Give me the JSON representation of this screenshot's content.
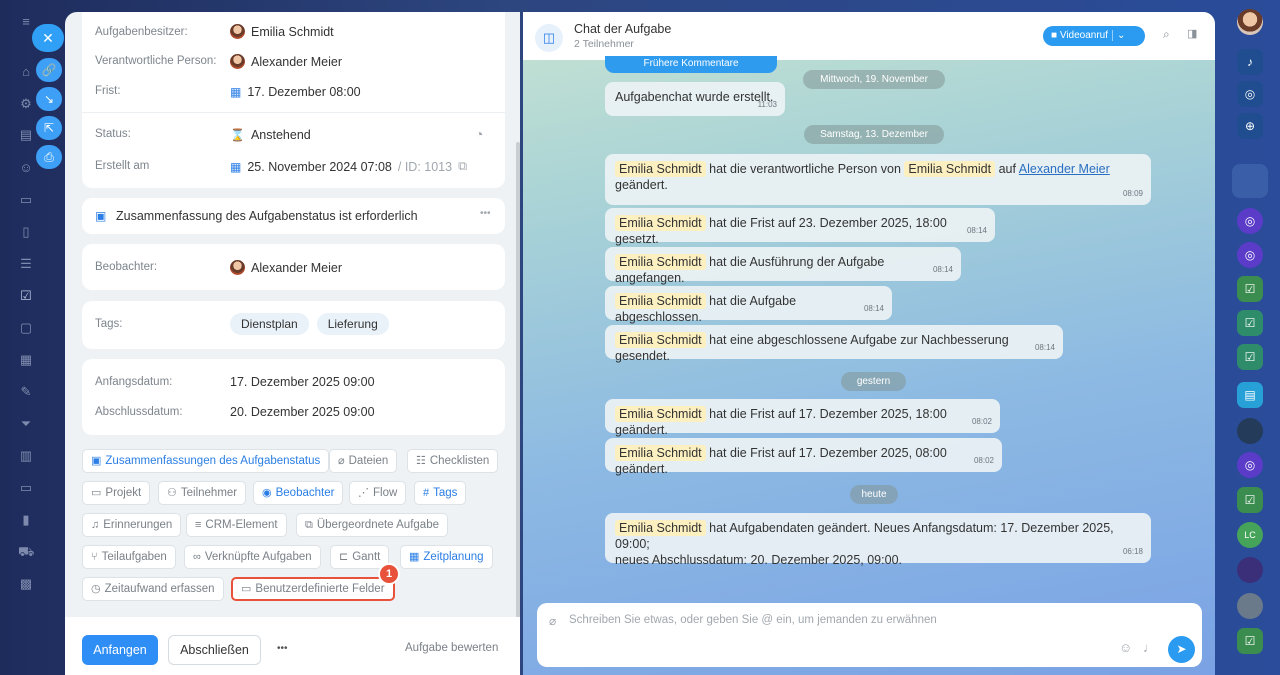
{
  "task": {
    "owner_label": "Aufgabenbesitzer:",
    "owner_name": "Emilia Schmidt",
    "responsible_label": "Verantwortliche Person:",
    "responsible_name": "Alexander Meier",
    "deadline_label": "Frist:",
    "deadline_value": "17. Dezember 08:00",
    "status_label": "Status:",
    "status_value": "Anstehend",
    "created_label": "Erstellt am",
    "created_value": "25. November 2024 07:08",
    "id_text": "/ ID: 1013",
    "summary_text": "Zusammenfassung des Aufgabenstatus ist erforderlich",
    "observer_label": "Beobachter:",
    "observer_name": "Alexander Meier",
    "tags_label": "Tags:",
    "tags": [
      "Dienstplan",
      "Lieferung"
    ],
    "start_label": "Anfangsdatum:",
    "start_value": "17. Dezember 2025 09:00",
    "end_label": "Abschlussdatum:",
    "end_value": "20. Dezember 2025 09:00",
    "chips": [
      "Zusammenfassungen des Aufgabenstatus",
      "Dateien",
      "Checklisten",
      "Projekt",
      "Teilnehmer",
      "Beobachter",
      "Flow",
      "Tags",
      "Erinnerungen",
      "CRM-Element",
      "Übergeordnete Aufgabe",
      "Teilaufgaben",
      "Verknüpfte Aufgaben",
      "Gantt",
      "Zeitplanung",
      "Zeitaufwand erfassen",
      "Benutzerdefinierte Felder"
    ],
    "badge_number": "1",
    "start_button": "Anfangen",
    "finish_button": "Abschließen",
    "more_button": "•••",
    "rate_link": "Aufgabe bewerten"
  },
  "chat": {
    "title": "Chat der Aufgabe",
    "subtitle": "2 Teilnehmer",
    "video_button": "Videoanruf",
    "earlier_comments": "Frühere Kommentare",
    "dates": [
      "Mittwoch, 19. November",
      "Samstag, 13. Dezember",
      "gestern",
      "heute"
    ],
    "messages": [
      {
        "text": "Aufgabenchat wurde erstellt.",
        "time": "11:03"
      },
      {
        "name": "Emilia Schmidt",
        "text1": "hat die verantwortliche Person von",
        "name2": "Emilia Schmidt",
        "text2": "auf",
        "link": "Alexander Meier",
        "text3": "geändert.",
        "time": "08:09"
      },
      {
        "name": "Emilia Schmidt",
        "text": "hat die Frist auf 23. Dezember 2025, 18:00 gesetzt.",
        "time": "08:14"
      },
      {
        "name": "Emilia Schmidt",
        "text": "hat die Ausführung der Aufgabe angefangen.",
        "time": "08:14"
      },
      {
        "name": "Emilia Schmidt",
        "text": "hat die Aufgabe abgeschlossen.",
        "time": "08:14"
      },
      {
        "name": "Emilia Schmidt",
        "text": "hat eine abgeschlossene Aufgabe zur Nachbesserung gesendet.",
        "time": "08:14"
      },
      {
        "name": "Emilia Schmidt",
        "text": "hat die Frist auf 17. Dezember 2025, 18:00 geändert.",
        "time": "08:02"
      },
      {
        "name": "Emilia Schmidt",
        "text": "hat die Frist auf 17. Dezember 2025, 08:00 geändert.",
        "time": "08:02"
      },
      {
        "name": "Emilia Schmidt",
        "text1": "hat Aufgabendaten geändert. Neues Anfangsdatum: 17. Dezember 2025, 09:00;",
        "text2": "neues Abschlussdatum: 20. Dezember 2025, 09:00.",
        "time": "06:18"
      }
    ],
    "composer_placeholder": "Schreiben Sie etwas, oder geben Sie @ ein, um jemanden zu erwähnen"
  },
  "rail": {
    "lc_avatar": "LC"
  },
  "colors": {
    "accent": "#2f8ef6",
    "badge": "#e8513a",
    "highlight": "#fdf0c0"
  }
}
